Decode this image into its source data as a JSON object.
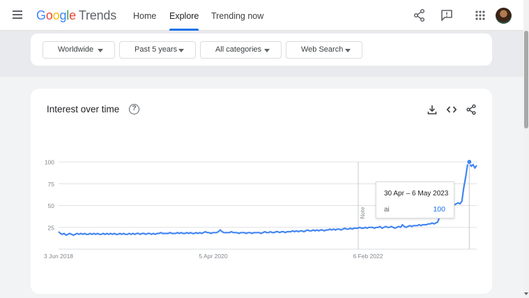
{
  "header": {
    "logo": {
      "google": "Google",
      "product": "Trends"
    },
    "nav": {
      "home": "Home",
      "explore": "Explore",
      "trending": "Trending now"
    },
    "icons": [
      "menu-icon",
      "share-icon",
      "feedback-icon",
      "apps-icon",
      "avatar"
    ]
  },
  "filters": {
    "region": "Worldwide",
    "time_range": "Past 5 years",
    "category": "All categories",
    "search_type": "Web Search"
  },
  "card": {
    "title": "Interest over time",
    "help_glyph": "?",
    "icons": [
      "download-icon",
      "embed-code-icon",
      "share-icon"
    ]
  },
  "tooltip": {
    "date": "30 Apr – 6 May 2023",
    "term": "ai",
    "value": "100"
  },
  "annotation": "Note",
  "colors": {
    "accent": "#1a73e8",
    "series": "#4285f4"
  },
  "chart_data": {
    "type": "line",
    "y_ticks": [
      25,
      50,
      75,
      100
    ],
    "ylim": [
      0,
      100
    ],
    "x_tick_labels": [
      "3 Jun 2018",
      "5 Apr 2020",
      "6 Feb 2022"
    ],
    "grid": true,
    "series": [
      {
        "name": "ai",
        "values": [
          20,
          18,
          17,
          18,
          16,
          17,
          18,
          17,
          16,
          17,
          18,
          17,
          18,
          17,
          18,
          17,
          17,
          18,
          17,
          18,
          17,
          18,
          17,
          17,
          18,
          17,
          18,
          17,
          18,
          17,
          18,
          17,
          17,
          18,
          17,
          18,
          17,
          17,
          18,
          17,
          18,
          17,
          18,
          18,
          17,
          18,
          18,
          17,
          18,
          18,
          17,
          18,
          17,
          18,
          18,
          19,
          18,
          18,
          18,
          18,
          19,
          18,
          18,
          18,
          19,
          18,
          19,
          18,
          18,
          19,
          18,
          19,
          18,
          18,
          19,
          18,
          19,
          18,
          19,
          20,
          19,
          19,
          18,
          19,
          19,
          19,
          20,
          22,
          20,
          19,
          19,
          19,
          19,
          20,
          19,
          19,
          19,
          18,
          19,
          19,
          19,
          18,
          19,
          19,
          18,
          19,
          19,
          19,
          19,
          18,
          19,
          20,
          19,
          19,
          20,
          19,
          19,
          20,
          20,
          19,
          20,
          20,
          19,
          20,
          20,
          20,
          21,
          20,
          21,
          20,
          21,
          21,
          20,
          21,
          22,
          21,
          21,
          22,
          21,
          22,
          21,
          22,
          22,
          21,
          22,
          22,
          23,
          22,
          23,
          22,
          23,
          23,
          22,
          23,
          24,
          23,
          23,
          24,
          23,
          24,
          24,
          24,
          25,
          24,
          24,
          25,
          24,
          25,
          25,
          25,
          24,
          25,
          25,
          26,
          24,
          25,
          26,
          25,
          25,
          26,
          25,
          24,
          25,
          26,
          25,
          28,
          26,
          25,
          26,
          27,
          26,
          27,
          27,
          27,
          28,
          27,
          28,
          28,
          28,
          29,
          29,
          30,
          29,
          30,
          31,
          37,
          40,
          42,
          45,
          48,
          50,
          49,
          52,
          51,
          52,
          53,
          52,
          55,
          70,
          82,
          96,
          100,
          95,
          97,
          93,
          96
        ]
      }
    ]
  }
}
